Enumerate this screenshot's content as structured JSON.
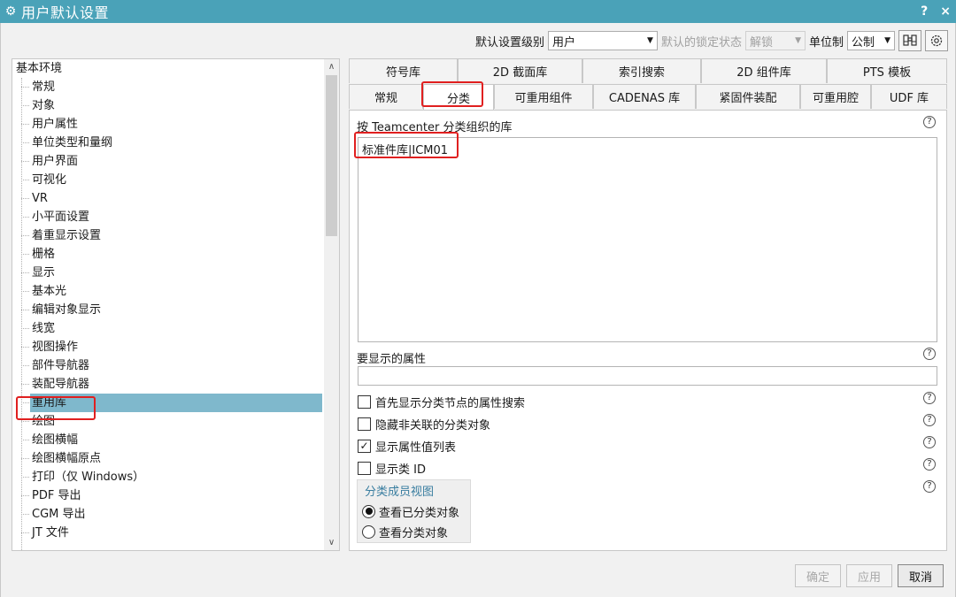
{
  "window": {
    "title": "用户默认设置",
    "help": "?",
    "close": "×"
  },
  "toolbar": {
    "level_label": "默认设置级别",
    "level_value": "用户",
    "lock_label": "默认的锁定状态",
    "lock_value": "解锁",
    "units_label": "单位制",
    "units_value": "公制"
  },
  "tree": {
    "root": "基本环境",
    "items": [
      "常规",
      "对象",
      "用户属性",
      "单位类型和量纲",
      "用户界面",
      "可视化",
      "VR",
      "小平面设置",
      "着重显示设置",
      "栅格",
      "显示",
      "基本光",
      "编辑对象显示",
      "线宽",
      "视图操作",
      "部件导航器",
      "装配导航器",
      "重用库",
      "绘图",
      "绘图横幅",
      "绘图横幅原点",
      "打印（仅 Windows）",
      "PDF 导出",
      "CGM 导出",
      "JT 文件"
    ],
    "selected": "重用库"
  },
  "tabs": {
    "row1": [
      "符号库",
      "2D 截面库",
      "索引搜索",
      "2D 组件库",
      "PTS 模板"
    ],
    "row2": [
      "常规",
      "分类",
      "可重用组件",
      "CADENAS 库",
      "紧固件装配",
      "可重用腔",
      "UDF 库"
    ],
    "active": "分类"
  },
  "panel": {
    "libs_label": "按 Teamcenter 分类组织的库",
    "libs_text": "标准件库|ICM01",
    "attrs_label": "要显示的属性",
    "attrs_value": "",
    "checks": [
      {
        "label": "首先显示分类节点的属性搜索",
        "checked": false
      },
      {
        "label": "隐藏非关联的分类对象",
        "checked": false
      },
      {
        "label": "显示属性值列表",
        "checked": true
      },
      {
        "label": "显示类 ID",
        "checked": false
      }
    ],
    "group_title": "分类成员视图",
    "radios": [
      {
        "label": "查看已分类对象",
        "selected": true
      },
      {
        "label": "查看分类对象",
        "selected": false
      }
    ]
  },
  "buttons": {
    "ok": "确定",
    "apply": "应用",
    "cancel": "取消"
  },
  "colors": {
    "titlebar": "#4aa2b8",
    "selection": "#7fb8cc",
    "annotation": "#e02020"
  }
}
